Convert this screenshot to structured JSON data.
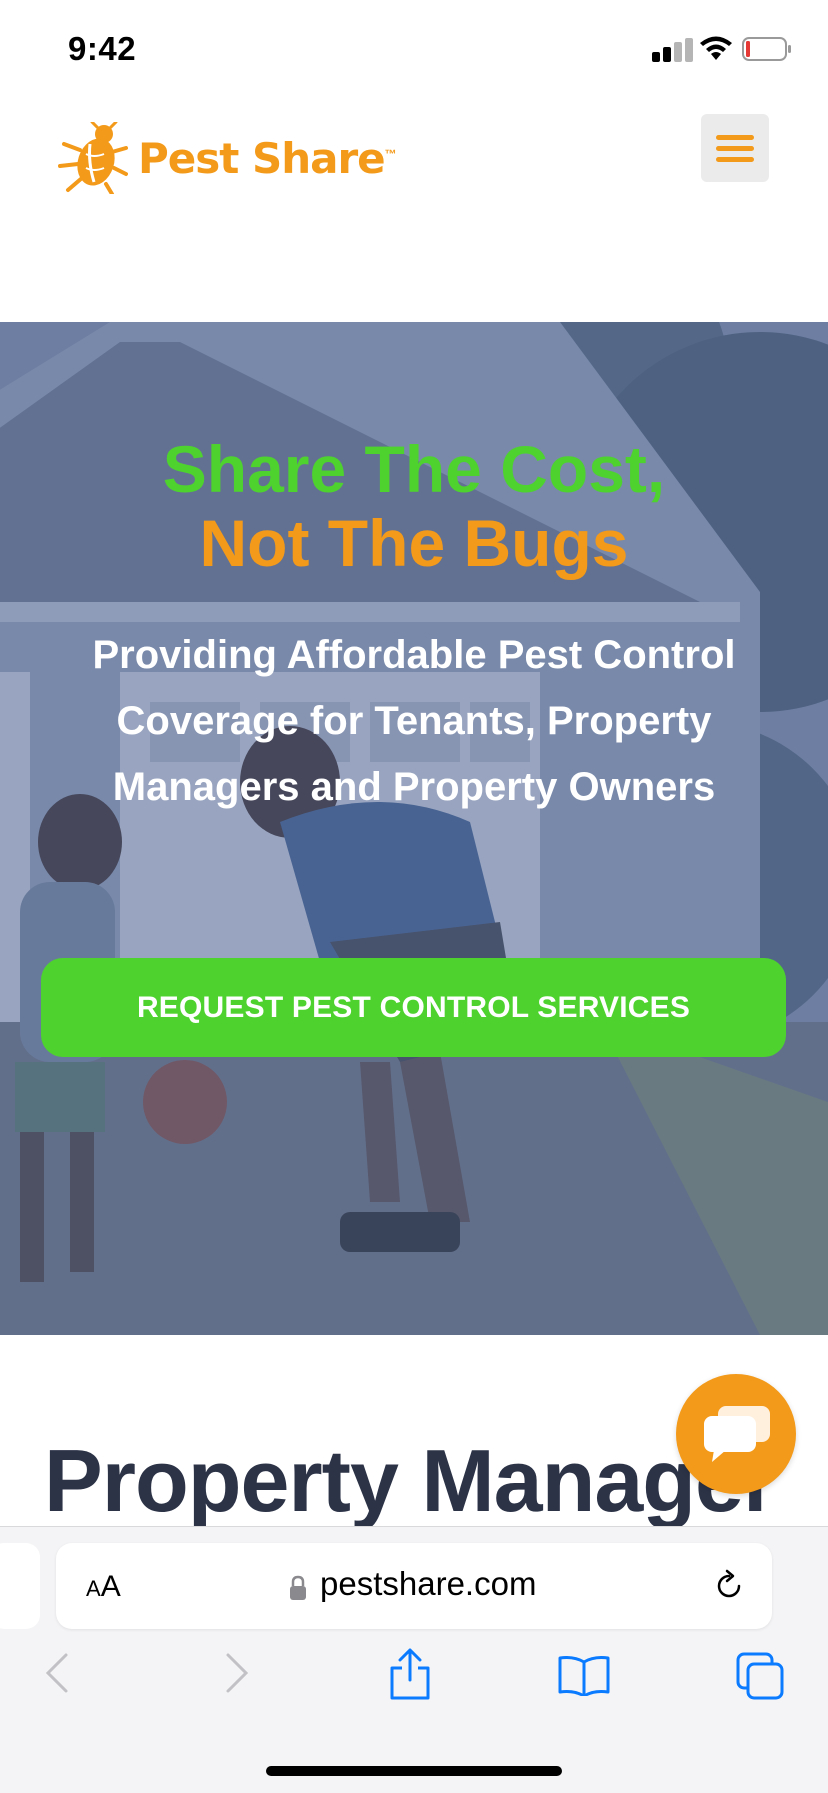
{
  "status_bar": {
    "time": "9:42",
    "icons": [
      "signal-icon",
      "wifi-icon",
      "battery-icon"
    ]
  },
  "header": {
    "logo_text": "Pest Share",
    "trademark": "™",
    "menu_icon": "hamburger-menu-icon"
  },
  "hero": {
    "title_line1": "Share The Cost,",
    "title_line2": "Not The Bugs",
    "subtitle": "Providing Affordable Pest Control Coverage for Tenants, Property Managers and Property Owners",
    "cta_label": "REQUEST PEST CONTROL SERVICES"
  },
  "section": {
    "heading": "Property Manager"
  },
  "chat_button": {
    "icon": "chat-bubbles-icon"
  },
  "browser": {
    "text_size_small": "A",
    "text_size_big": "A",
    "url": "pestshare.com",
    "toolbar_icons": [
      "back-icon",
      "forward-icon",
      "share-icon",
      "bookmarks-icon",
      "tabs-icon"
    ]
  },
  "colors": {
    "brand_orange": "#f39a1a",
    "brand_green": "#4ed32e",
    "heading_navy": "#2c3347",
    "hero_overlay": "#5468a0"
  }
}
